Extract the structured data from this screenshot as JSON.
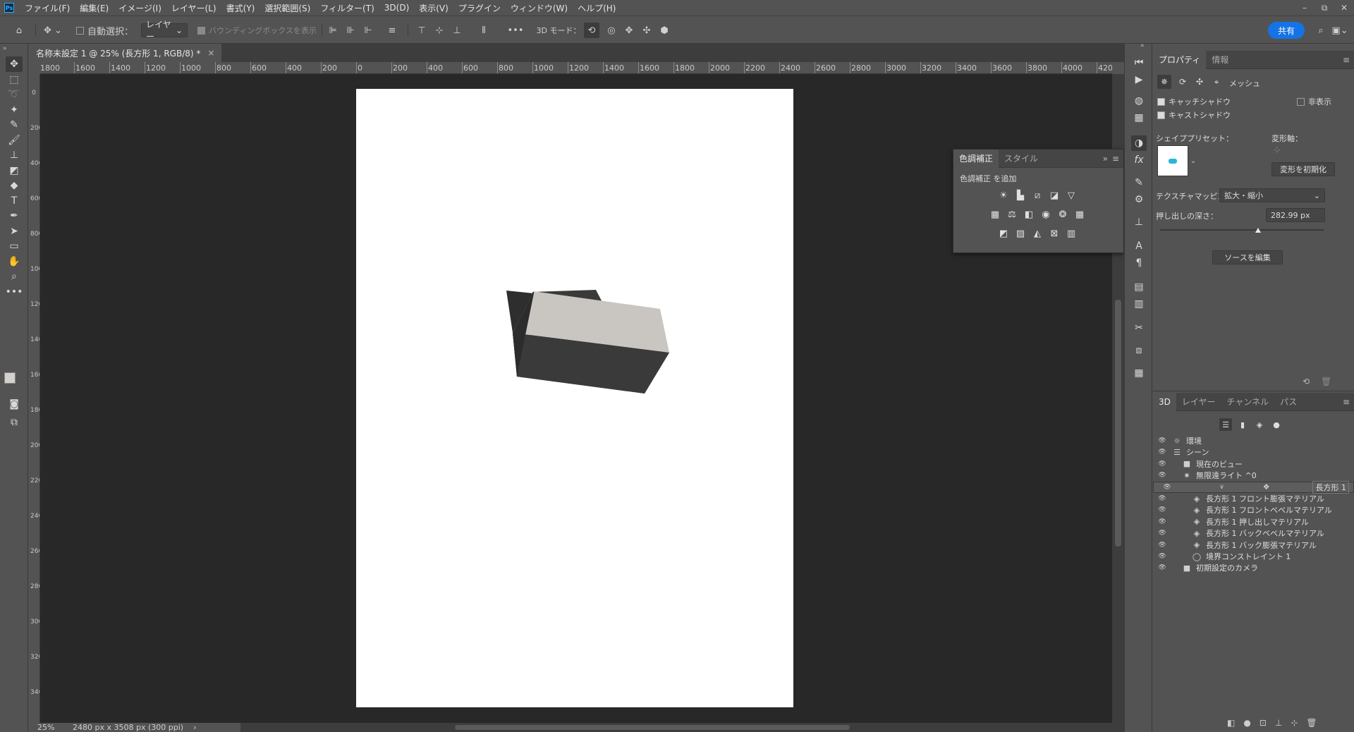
{
  "menubar": {
    "logo": "Ps",
    "items": [
      "ファイル(F)",
      "編集(E)",
      "イメージ(I)",
      "レイヤー(L)",
      "書式(Y)",
      "選択範囲(S)",
      "フィルター(T)",
      "3D(D)",
      "表示(V)",
      "プラグイン",
      "ウィンドウ(W)",
      "ヘルプ(H)"
    ]
  },
  "window_controls": {
    "minimize": "–",
    "restore": "⧉",
    "close": "✕"
  },
  "options": {
    "auto_select_label": "自動選択：",
    "auto_select_value": "レイヤー",
    "bounding_box_label": "バウンディングボックスを表示",
    "mode_3d_label": "3D モード：",
    "share_label": "共有",
    "more": "•••"
  },
  "tools": [
    {
      "name": "move-tool-icon",
      "glyph": "✥"
    },
    {
      "name": "marquee-tool-icon",
      "glyph": "⬚"
    },
    {
      "name": "lasso-tool-icon",
      "glyph": "➰"
    },
    {
      "name": "magic-wand-tool-icon",
      "glyph": "✦"
    },
    {
      "name": "eyedropper-tool-icon",
      "glyph": "✎"
    },
    {
      "name": "brush-tool-icon",
      "glyph": "🖌"
    },
    {
      "name": "stamp-tool-icon",
      "glyph": "⊥"
    },
    {
      "name": "eraser-tool-icon",
      "glyph": "◩"
    },
    {
      "name": "paint-bucket-tool-icon",
      "glyph": "◆"
    },
    {
      "name": "type-tool-icon",
      "glyph": "T"
    },
    {
      "name": "pen-tool-icon",
      "glyph": "✒"
    },
    {
      "name": "path-select-tool-icon",
      "glyph": "➤"
    },
    {
      "name": "rectangle-tool-icon",
      "glyph": "▭"
    },
    {
      "name": "hand-tool-icon",
      "glyph": "✋"
    },
    {
      "name": "zoom-tool-icon",
      "glyph": "⌕"
    },
    {
      "name": "more-tools-icon",
      "glyph": "•••"
    }
  ],
  "document": {
    "tab_title": "名称未設定 1 @ 25% (長方形 1, RGB/8) *",
    "tab_close": "×",
    "zoom": "25%",
    "doc_info": "2480 px x 3508 px (300 ppi)"
  },
  "ruler": {
    "top_labels": [
      "1800",
      "1600",
      "1400",
      "1200",
      "1000",
      "800",
      "600",
      "400",
      "200",
      "0",
      "200",
      "400",
      "600",
      "800",
      "1000",
      "1200",
      "1400",
      "1600",
      "1800",
      "2000",
      "2200",
      "2400",
      "2600",
      "2800",
      "3000",
      "3200",
      "3400",
      "3600",
      "3800",
      "4000",
      "420"
    ],
    "left_labels": [
      "0",
      "200",
      "400",
      "600",
      "800",
      "1000",
      "1200",
      "1400",
      "1600",
      "1800",
      "2000",
      "2200",
      "2400",
      "2600",
      "2800",
      "3000",
      "3200",
      "3400"
    ]
  },
  "adjustments_panel": {
    "tab_active": "色調補正",
    "tab_other": "スタイル",
    "title": "色調補正 を追加",
    "collapse": "»",
    "menu": "≡"
  },
  "properties_panel": {
    "tab_active": "プロパティ",
    "tab_other": "情報",
    "mesh_label": "メッシュ",
    "catch_shadow": "キャッチシャドウ",
    "cast_shadow": "キャストシャドウ",
    "invisible": "非表示",
    "shape_preset_label": "シェイププリセット：",
    "deform_axis_label": "変形軸：",
    "reset_deform": "変形を初期化",
    "texture_mapping_label": "テクスチャマッピング：",
    "texture_mapping_value": "拡大・縮小",
    "extrusion_depth_label": "押し出しの深さ：",
    "extrusion_depth_value": "282.99 px",
    "extrusion_depth_fraction": 0.6,
    "edit_source": "ソースを編集",
    "menu": "≡"
  },
  "layers_panel": {
    "tabs": [
      "3D",
      "レイヤー",
      "チャンネル",
      "パス"
    ],
    "menu": "≡",
    "rows": [
      {
        "label": "環境",
        "icon": "☼",
        "indent": 0,
        "selected": false
      },
      {
        "label": "シーン",
        "icon": "☰",
        "indent": 0,
        "selected": false
      },
      {
        "label": "現在のビュー",
        "icon": "■",
        "indent": 1,
        "selected": false
      },
      {
        "label": "無限遠ライト ^0",
        "icon": "✷",
        "indent": 1,
        "selected": false
      },
      {
        "label": "長方形 1",
        "icon": "❖",
        "indent": 1,
        "selected": true,
        "expand": "∨"
      },
      {
        "label": "長方形 1 フロント膨張マテリアル",
        "icon": "◈",
        "indent": 2,
        "selected": false
      },
      {
        "label": "長方形 1 フロントベベルマテリアル",
        "icon": "◈",
        "indent": 2,
        "selected": false
      },
      {
        "label": "長方形 1 押し出しマテリアル",
        "icon": "◈",
        "indent": 2,
        "selected": false
      },
      {
        "label": "長方形 1 バックベベルマテリアル",
        "icon": "◈",
        "indent": 2,
        "selected": false
      },
      {
        "label": "長方形 1 バック膨張マテリアル",
        "icon": "◈",
        "indent": 2,
        "selected": false
      },
      {
        "label": "境界コンストレイント 1",
        "icon": "◯",
        "indent": 2,
        "selected": false
      },
      {
        "label": "初期設定のカメラ",
        "icon": "■",
        "indent": 1,
        "selected": false
      }
    ]
  },
  "colors": {
    "accent": "#1473e6",
    "box_top": "#c9c5c1",
    "box_front": "#3a3a3a",
    "box_side": "#2c2c2c"
  }
}
